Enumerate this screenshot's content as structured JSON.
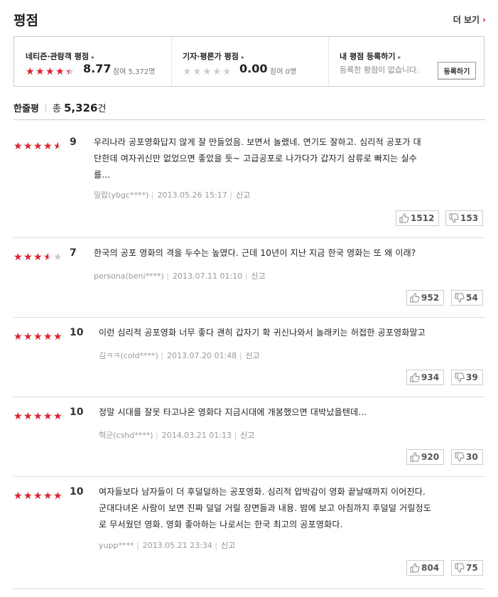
{
  "header": {
    "title": "평점",
    "more_label": "더 보기",
    "more_chevron": "›"
  },
  "summary_box": {
    "netizen": {
      "title": "네티즌·관람객 평점",
      "arrow": "▸",
      "score": "8.77",
      "participants": "참여 5,372명",
      "rating": 8.77
    },
    "critic": {
      "title": "기자·평론가 평점",
      "arrow": "▸",
      "score": "0.00",
      "participants": "참여 0명",
      "rating": 0
    },
    "mine": {
      "title": "내 평점 등록하기",
      "arrow": "▸",
      "text": "등록한 평점이 없습니다.",
      "button_label": "등록하기"
    }
  },
  "reviews_header": {
    "label": "한줄평",
    "total_prefix": "총",
    "total_count": "5,326",
    "total_suffix": "건"
  },
  "reviews": [
    {
      "rating": 9,
      "score": "9",
      "lines": [
        "우리나라 공포영화답지 않게 잘 만들었음. 보면서 놀랬네. 연기도 잘하고. 심리적 공포가 대",
        "단한데 여자귀신만 없었으면 좋았을 듯~ 고급공포로 나가다가 갑자기 삼류로 빠지는 실수",
        "를..."
      ],
      "user": "밀랍(ybgc****)",
      "date": "2013.05.26 15:17",
      "report": "신고",
      "likes": "1512",
      "dislikes": "153"
    },
    {
      "rating": 7,
      "score": "7",
      "lines": [
        "한국의 공포 영화의 격을 두수는 높였다. 근데 10년이 지난 지금 한국 영화는 또 왜 이래?"
      ],
      "user": "persona(beni****)",
      "date": "2013.07.11 01:10",
      "report": "신고",
      "likes": "952",
      "dislikes": "54"
    },
    {
      "rating": 10,
      "score": "10",
      "lines": [
        "이런 심리적 공포영화 너무 좋다 괜히 갑자기 확 귀신나와서 놀래키는 허접한 공포영화말고"
      ],
      "user": "김ㅋㅋ(cold****)",
      "date": "2013.07.20 01:48",
      "report": "신고",
      "likes": "934",
      "dislikes": "39"
    },
    {
      "rating": 10,
      "score": "10",
      "lines": [
        "정말 시대를 잘못 타고나온 영화다 지금시대에 개봉했으면 대박났을텐데..."
      ],
      "user": "혁군(cshd****)",
      "date": "2014.03.21 01:13",
      "report": "신고",
      "likes": "920",
      "dislikes": "30"
    },
    {
      "rating": 10,
      "score": "10",
      "lines": [
        "여자들보다 남자들이 더 후덜덜하는 공포영화. 심리적 압박감이 영화 끝날때까지 이어진다.",
        "군대다녀온 사람이 보면 진짜 덜덜 거릴 장면들과 내용. 밤에 보고 아침까지 후덜덜 거릴정도",
        "로 무서웠던 영화. 영화 좋아하는 나로서는 한국 최고의 공포영화다."
      ],
      "user": "yupp****",
      "date": "2013.05.21 23:34",
      "report": "신고",
      "likes": "804",
      "dislikes": "75"
    }
  ],
  "colors": {
    "accent": "#e0202c",
    "star_empty": "#cccccc"
  },
  "icons": {
    "thumbs_up": "thumbs-up-icon",
    "thumbs_down": "thumbs-down-icon",
    "star": "star-icon"
  }
}
